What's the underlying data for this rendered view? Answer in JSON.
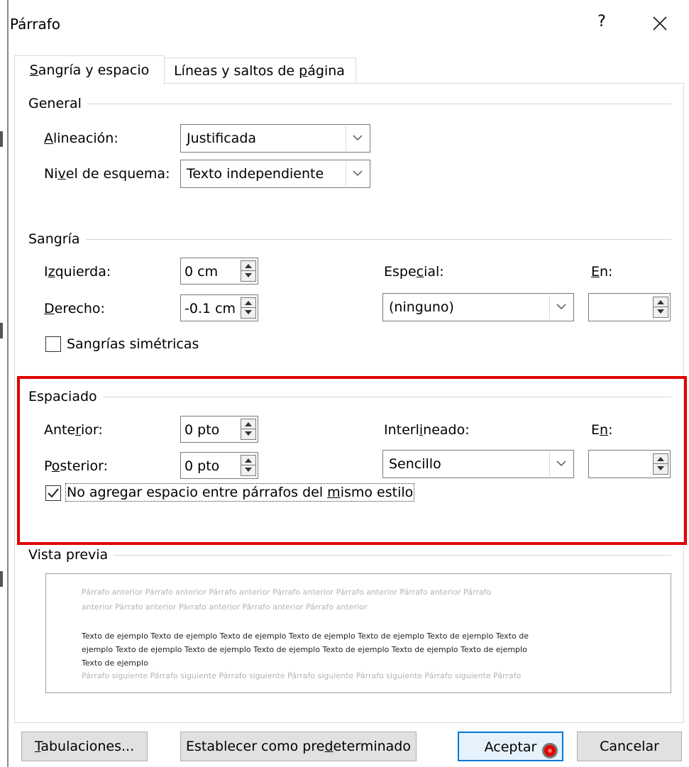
{
  "window": {
    "title": "Párrafo",
    "help_label": "?",
    "close_label": "✕"
  },
  "tabs": [
    {
      "label_pre": "",
      "label_key": "S",
      "label_post": "angría y espacio",
      "active": true
    },
    {
      "label_pre": "Líneas y saltos de ",
      "label_key": "p",
      "label_post": "ágina",
      "active": false
    }
  ],
  "general": {
    "title": "General",
    "alignment": {
      "label_pre": "",
      "label_key": "A",
      "label_post": "lineación:",
      "value": "Justificada"
    },
    "outline": {
      "label_pre": "Ni",
      "label_key": "v",
      "label_post": "el de esquema:",
      "value": "Texto independiente"
    }
  },
  "indent": {
    "title": "Sangría",
    "left": {
      "label_pre": "I",
      "label_key": "z",
      "label_post": "quierda:",
      "value": "0 cm"
    },
    "right": {
      "label_pre": "",
      "label_key": "D",
      "label_post": "erecho:",
      "value": "-0.1 cm"
    },
    "special": {
      "label_pre": "Espe",
      "label_key": "c",
      "label_post": "ial:",
      "value": "(ninguno)"
    },
    "by": {
      "label_pre": "",
      "label_key": "E",
      "label_post": "n:",
      "value": ""
    },
    "mirror": {
      "label_pre": "San",
      "label_key": "g",
      "label_post": "rías simétricas",
      "checked": false
    }
  },
  "spacing": {
    "title": "Espaciado",
    "before": {
      "label_pre": "Ante",
      "label_key": "r",
      "label_post": "ior:",
      "value": "0 pto"
    },
    "after": {
      "label_pre": "P",
      "label_key": "o",
      "label_post": "sterior:",
      "value": "0 pto"
    },
    "line_spacing": {
      "label_pre": "Interl",
      "label_key": "i",
      "label_post": "neado:",
      "value": "Sencillo"
    },
    "at": {
      "label_pre": "E",
      "label_key": "n",
      "label_post": ":",
      "value": ""
    },
    "no_space": {
      "label_pre": "No agregar espacio entre párrafos del ",
      "label_key": "m",
      "label_post": "ismo estilo",
      "checked": true
    }
  },
  "preview": {
    "title": "Vista previa",
    "prev_lines": [
      "Párrafo anterior Párrafo anterior Párrafo anterior Párrafo anterior Párrafo anterior Párrafo anterior Párrafo",
      "anterior Párrafo anterior Párrafo anterior Párrafo anterior Párrafo anterior"
    ],
    "sample_lines": [
      "Texto de ejemplo Texto de ejemplo Texto de ejemplo Texto de ejemplo Texto de ejemplo Texto de ejemplo Texto de",
      "ejemplo Texto de ejemplo Texto de ejemplo Texto de ejemplo Texto de ejemplo Texto de ejemplo Texto de ejemplo",
      "Texto de ejemplo"
    ],
    "next_lines": [
      "Párrafo siguiente Párrafo siguiente Párrafo siguiente Párrafo siguiente Párrafo siguiente Párrafo siguiente Párrafo"
    ]
  },
  "buttons": {
    "tabs": {
      "label_pre": "",
      "label_key": "T",
      "label_post": "abulaciones..."
    },
    "default": {
      "label_pre": "Establecer como pre",
      "label_key": "d",
      "label_post": "eterminado"
    },
    "ok": {
      "label": "Aceptar"
    },
    "cancel": {
      "label": "Cancelar"
    }
  },
  "colors": {
    "highlight_border": "#e00000",
    "default_button_border": "#0078d7"
  }
}
